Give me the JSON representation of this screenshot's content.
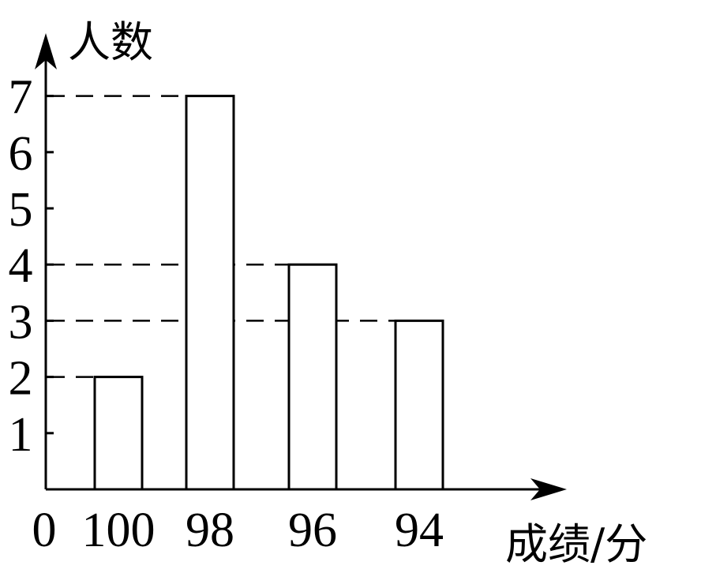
{
  "chart_data": {
    "type": "bar",
    "categories": [
      "100",
      "98",
      "96",
      "94"
    ],
    "values": [
      2,
      7,
      4,
      3
    ],
    "xlabel": "成绩/分",
    "ylabel": "人数",
    "origin_label": "0",
    "yticks": [
      1,
      2,
      3,
      4,
      5,
      6,
      7
    ],
    "ylim": [
      0,
      7
    ],
    "dashed_guides": [
      2,
      3,
      4,
      7
    ],
    "grid": false,
    "legend": "none",
    "bar_fill": "#ffffff",
    "stroke_color": "#000000"
  }
}
